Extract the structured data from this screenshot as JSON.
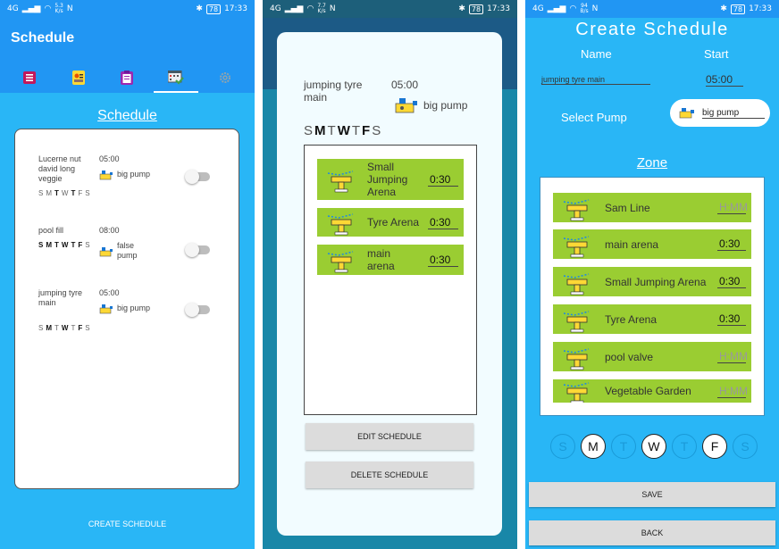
{
  "status": {
    "time": "17:33",
    "battery": "78",
    "p1_speed": [
      "5.3",
      "K/s"
    ],
    "p2_speed": [
      "7.7",
      "K/s"
    ],
    "p3_speed": [
      "94",
      "B/s"
    ],
    "network": "4G"
  },
  "screen1": {
    "title": "Schedule",
    "tab_icons": [
      "list-icon",
      "contact-card-icon",
      "clipboard-icon",
      "calendar-check-icon",
      "gear-icon"
    ],
    "heading": "Schedule",
    "schedules": [
      {
        "name": "Lucerne nut david long veggie",
        "time": "05:00",
        "pump": "big pump",
        "days": [
          "S",
          "M",
          "T",
          "W",
          "T",
          "F",
          "S"
        ],
        "days_on": [
          false,
          false,
          true,
          false,
          true,
          false,
          false
        ]
      },
      {
        "name": "pool fill",
        "time": "08:00",
        "pump": "false pump",
        "days": [
          "S",
          "M",
          "T",
          "W",
          "T",
          "F",
          "S"
        ],
        "days_on": [
          true,
          true,
          true,
          true,
          true,
          true,
          false
        ]
      },
      {
        "name": "jumping tyre main",
        "time": "05:00",
        "pump": "big pump",
        "days": [
          "S",
          "M",
          "T",
          "W",
          "T",
          "F",
          "S"
        ],
        "days_on": [
          false,
          true,
          false,
          true,
          false,
          true,
          false
        ]
      }
    ],
    "create_label": "CREATE SCHEDULE"
  },
  "screen2": {
    "name": "jumping tyre main",
    "time": "05:00",
    "pump": "big pump",
    "days": [
      "S",
      "M",
      "T",
      "W",
      "T",
      "F",
      "S"
    ],
    "days_on": [
      false,
      true,
      false,
      true,
      false,
      true,
      false
    ],
    "zones": [
      {
        "name": "Small Jumping Arena",
        "duration": "0:30"
      },
      {
        "name": "Tyre Arena",
        "duration": "0:30"
      },
      {
        "name": "main arena",
        "duration": "0:30"
      }
    ],
    "edit_label": "EDIT SCHEDULE",
    "delete_label": "DELETE SCHEDULE"
  },
  "screen3": {
    "title": "Create Schedule",
    "name_label": "Name",
    "start_label": "Start",
    "name_value": "jumping tyre main",
    "start_value": "05:00",
    "select_pump_label": "Select Pump",
    "pump_value": "big pump",
    "zone_heading": "Zone",
    "zones": [
      {
        "name": "Sam Line",
        "duration": "",
        "placeholder": "H:MM"
      },
      {
        "name": "main arena",
        "duration": "0:30",
        "placeholder": "H:MM"
      },
      {
        "name": "Small Jumping Arena",
        "duration": "0:30",
        "placeholder": "H:MM"
      },
      {
        "name": "Tyre Arena",
        "duration": "0:30",
        "placeholder": "H:MM"
      },
      {
        "name": "pool valve",
        "duration": "",
        "placeholder": "H:MM"
      },
      {
        "name": "Vegetable Garden",
        "duration": "",
        "placeholder": "H:MM"
      }
    ],
    "days": [
      "S",
      "M",
      "T",
      "W",
      "T",
      "F",
      "S"
    ],
    "days_on": [
      false,
      true,
      false,
      true,
      false,
      true,
      false
    ],
    "save_label": "SAVE",
    "back_label": "BACK"
  },
  "colors": {
    "primary": "#2196f3",
    "background": "#29b6f6",
    "zone_green": "#9acd32",
    "dialog_overlay": "#1d6f8a"
  }
}
